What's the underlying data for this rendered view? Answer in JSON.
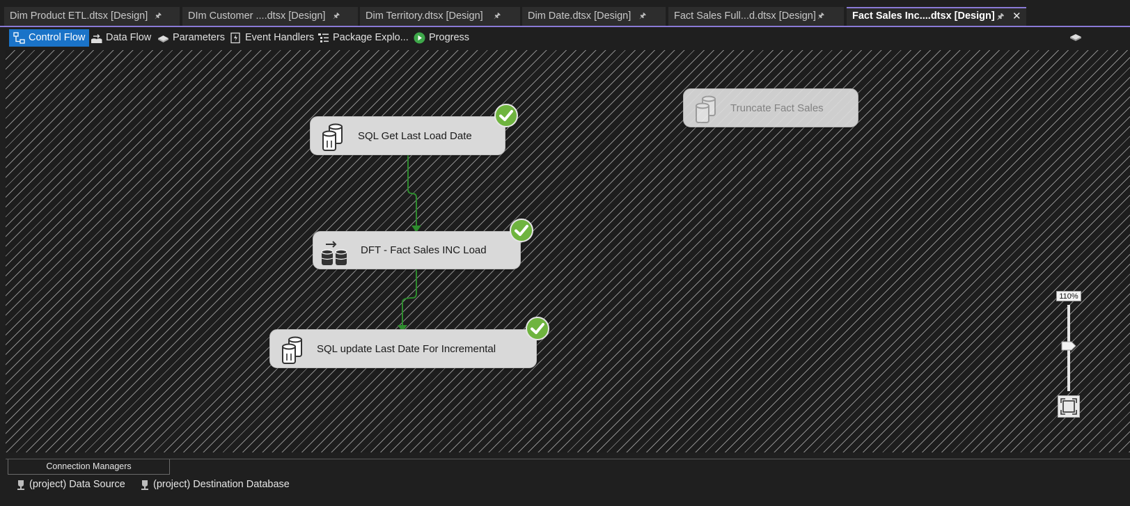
{
  "tabs": [
    {
      "label": "Dim Product ETL.dtsx [Design]",
      "pin": "pin-icon"
    },
    {
      "label": "DIm Customer ....dtsx [Design]",
      "pin": "pin-icon"
    },
    {
      "label": "Dim Territory.dtsx [Design]",
      "pin": "pin-icon"
    },
    {
      "label": "Dim Date.dtsx [Design]",
      "pin": "pin-icon"
    },
    {
      "label": "Fact Sales Full...d.dtsx [Design]",
      "pin": "pin-icon"
    },
    {
      "label": "Fact Sales Inc....dtsx [Design]",
      "pin": "pin-icon",
      "close": "✕",
      "active": true
    }
  ],
  "toolbar": {
    "items": [
      {
        "label": "Control Flow",
        "icon": "control-flow-icon"
      },
      {
        "label": "Data Flow",
        "icon": "data-flow-icon"
      },
      {
        "label": "Parameters",
        "icon": "parameters-icon"
      },
      {
        "label": "Event Handlers",
        "icon": "event-handlers-icon"
      },
      {
        "label": "Package Explo...",
        "icon": "package-explorer-icon"
      },
      {
        "label": "Progress",
        "icon": "play-icon"
      }
    ],
    "active": "Control Flow"
  },
  "canvas": {
    "tasks": [
      {
        "label": "SQL Get Last Load Date",
        "type": "execute-sql",
        "status": "success"
      },
      {
        "label": "DFT - Fact Sales INC Load",
        "type": "data-flow",
        "status": "success"
      },
      {
        "label": "SQL update Last Date For Incremental",
        "type": "execute-sql",
        "status": "success"
      },
      {
        "label": "Truncate Fact Sales",
        "type": "execute-sql",
        "status": "disabled"
      }
    ],
    "zoom": "110%"
  },
  "connection_managers": {
    "tab_label": "Connection Managers",
    "items": [
      {
        "label": "(project) Data Source",
        "icon": "connection-icon"
      },
      {
        "label": "(project) Destination Database",
        "icon": "connection-icon"
      }
    ]
  },
  "colors": {
    "accent": "#8a7ad6",
    "active_toolbar": "#1a73c8",
    "success": "#6fb43f",
    "precedence_line": "#2e8b2e",
    "task_fill": "#d9d9d9"
  }
}
